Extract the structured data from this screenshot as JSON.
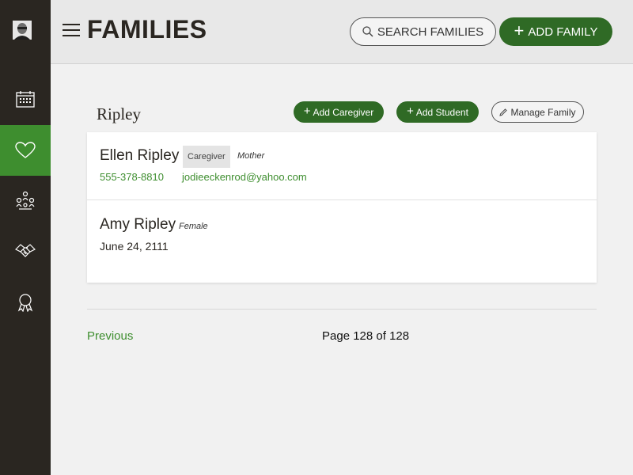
{
  "header": {
    "title": "FAMILIES",
    "search_label": "SEARCH FAMILIES",
    "add_family_label": "ADD FAMILY"
  },
  "sidebar": {
    "items": [
      {
        "icon": "calendar-icon",
        "active": false
      },
      {
        "icon": "heart-icon",
        "active": true
      },
      {
        "icon": "people-icon",
        "active": false
      },
      {
        "icon": "handshake-icon",
        "active": false
      },
      {
        "icon": "award-ribbon-icon",
        "active": false
      }
    ]
  },
  "family": {
    "name": "Ripley",
    "add_caregiver_label": "Add Caregiver",
    "add_student_label": "Add Student",
    "manage_family_label": "Manage Family",
    "members": [
      {
        "name": "Ellen Ripley",
        "role": "Caregiver",
        "relation": "Mother",
        "phone": "555-378-8810",
        "email": "jodieeckenrod@yahoo.com"
      },
      {
        "name": "Amy Ripley",
        "gender": "Female",
        "birthdate": "June 24, 2111"
      }
    ]
  },
  "pagination": {
    "previous_label": "Previous",
    "page_text": "Page 128 of 128"
  },
  "colors": {
    "sidebar_bg": "#2a2621",
    "active_green": "#3e8e2f",
    "button_green": "#2f6a25",
    "link_green": "#3e8e2f"
  }
}
